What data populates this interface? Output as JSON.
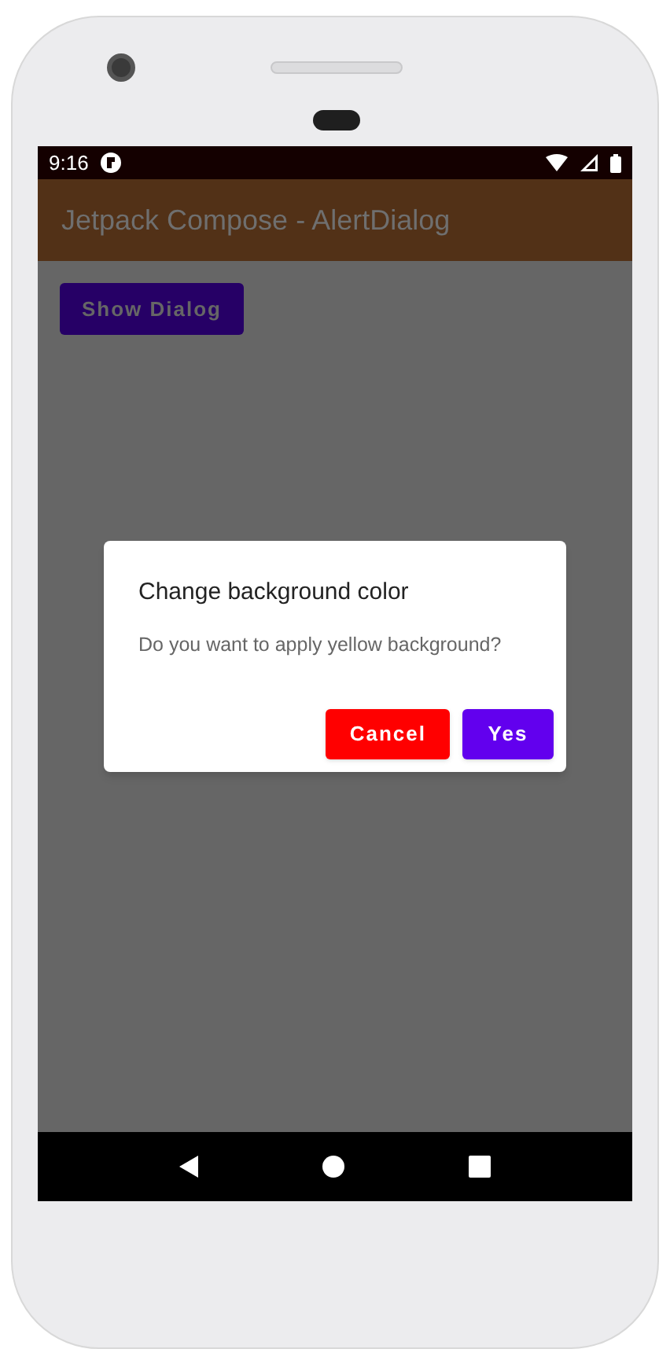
{
  "status_bar": {
    "time": "9:16"
  },
  "app_bar": {
    "title": "Jetpack Compose - AlertDialog"
  },
  "content": {
    "button": "Show Dialog"
  },
  "dialog": {
    "title": "Change background color",
    "message": "Do you want to apply yellow background?",
    "buttons": [
      {
        "label": "Cancel",
        "color": "#ff0000"
      },
      {
        "label": "Yes",
        "color": "#6200ee"
      }
    ]
  }
}
